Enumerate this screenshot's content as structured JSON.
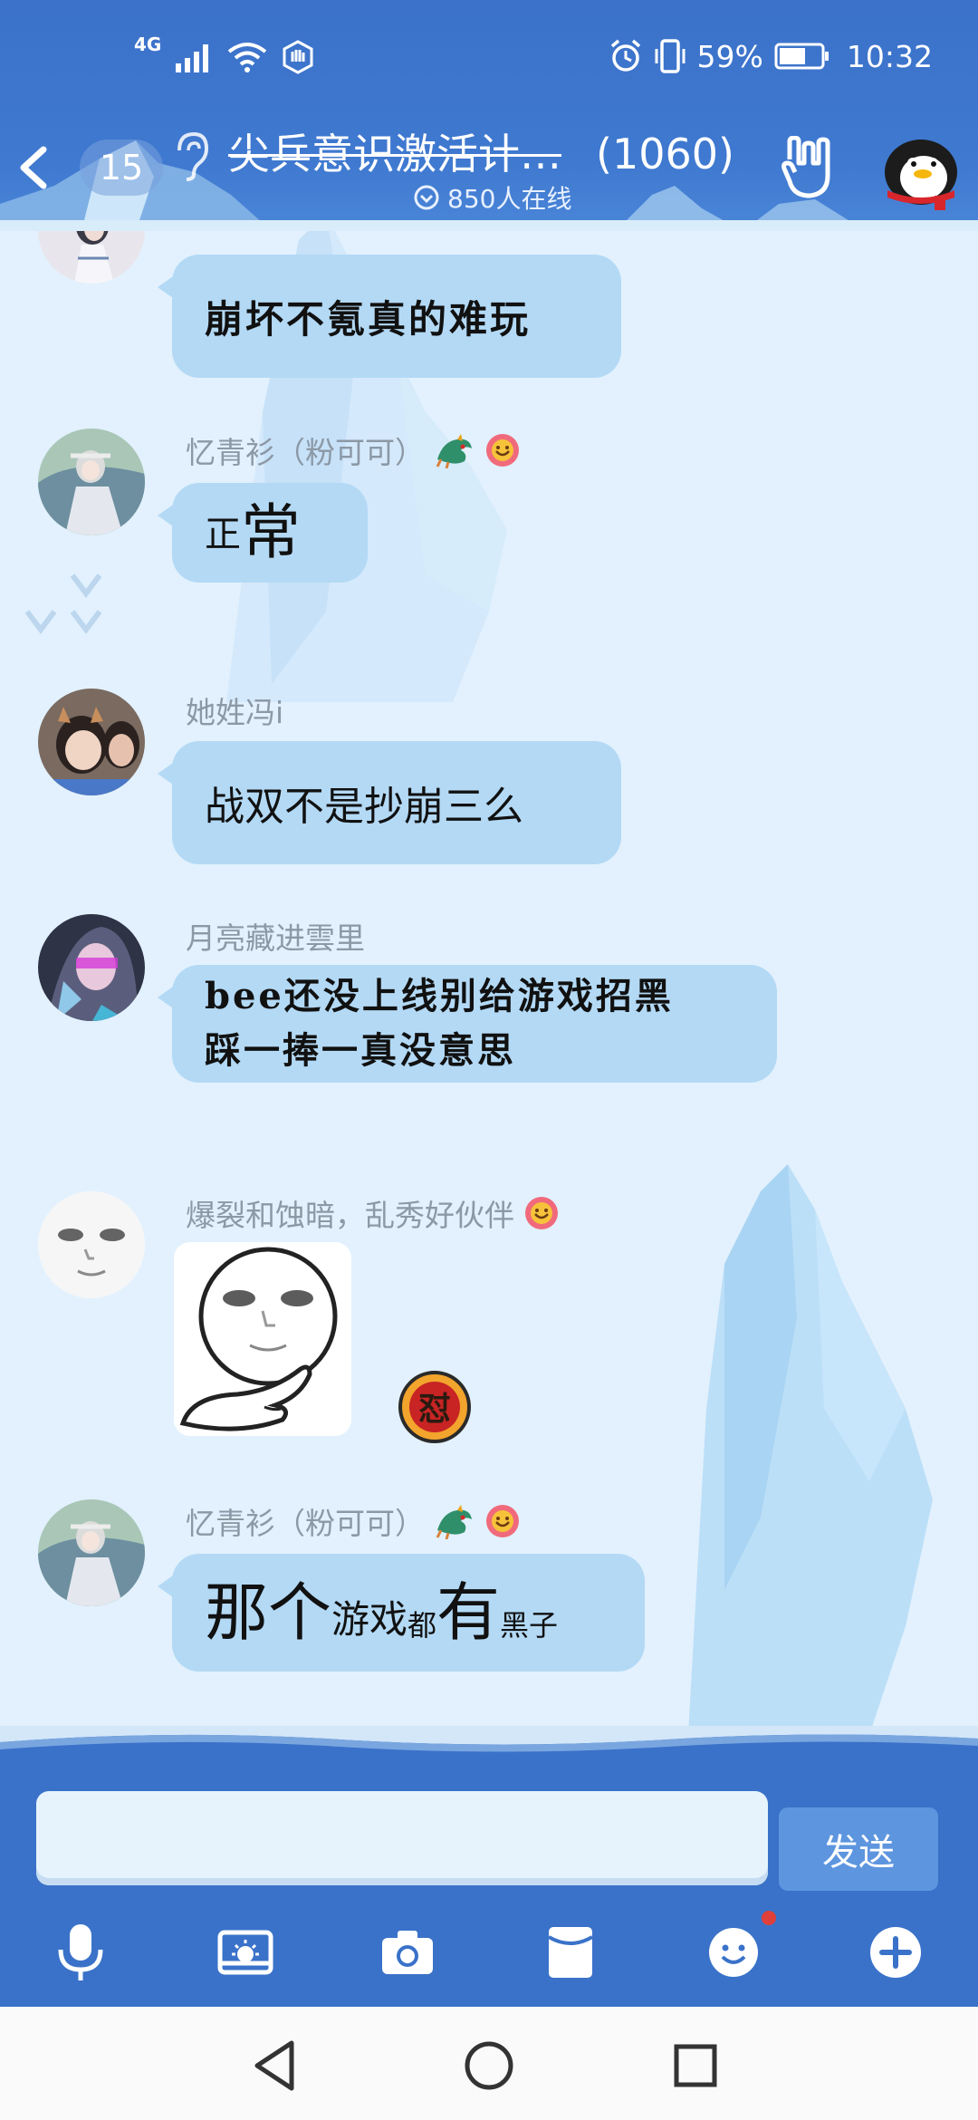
{
  "status_bar": {
    "network": "4G",
    "battery_percent": "59%",
    "time": "10:32"
  },
  "header": {
    "unread_count": "15",
    "group_name": "尖兵意识激活计…",
    "member_count": "(1060)",
    "online_text": "850人在线"
  },
  "messages": [
    {
      "sender": "",
      "text": "崩坏不氪真的难玩"
    },
    {
      "sender": "忆青衫（粉可可）",
      "text_small": "正",
      "text_large": "常"
    },
    {
      "sender": "她姓冯i",
      "text": "战双不是抄崩三么"
    },
    {
      "sender": "月亮藏进雲里",
      "line1": "bee还没上线别给游戏招黑",
      "line2": "踩一捧一真没意思"
    },
    {
      "sender": "爆裂和蚀暗，乱秀好伙伴",
      "sticker": "meme-face-sticker",
      "badge": "怼"
    },
    {
      "sender": "忆青衫（粉可可）",
      "parts": [
        "那个",
        "游戏",
        "都",
        "有",
        "黑子"
      ]
    }
  ],
  "input": {
    "value": "",
    "send_label": "发送"
  },
  "toolbar": {
    "icons": [
      "microphone-icon",
      "image-icon",
      "camera-icon",
      "red-packet-icon",
      "emoji-icon",
      "plus-icon"
    ]
  },
  "colors": {
    "header": "#3c72c9",
    "bubble": "#b3d9f5",
    "chat_bg": "#e2f1fd"
  }
}
